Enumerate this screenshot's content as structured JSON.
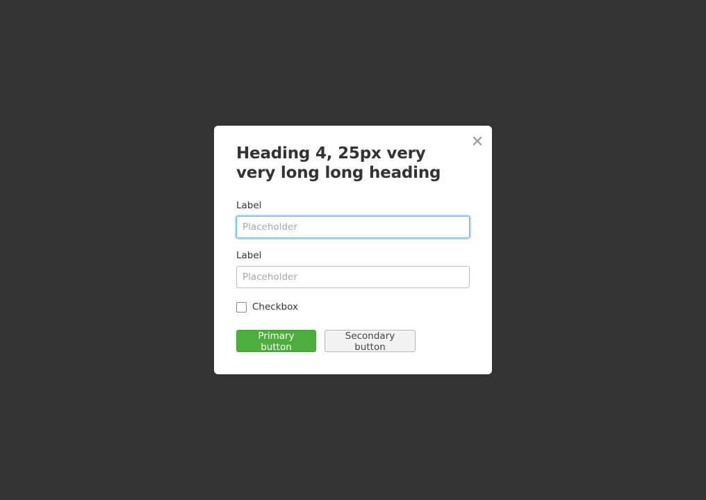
{
  "modal": {
    "heading": "Heading 4, 25px very very long long heading",
    "close_icon": "close-icon",
    "fields": [
      {
        "label": "Label",
        "placeholder": "Placeholder",
        "value": ""
      },
      {
        "label": "Label",
        "placeholder": "Placeholder",
        "value": ""
      }
    ],
    "checkbox": {
      "label": "Checkbox",
      "checked": false
    },
    "primary_button": "Primary button",
    "secondary_button": "Secondary button"
  },
  "colors": {
    "backdrop": "#333333",
    "primary": "#4cae3c",
    "focus_ring": "#66afe9"
  }
}
